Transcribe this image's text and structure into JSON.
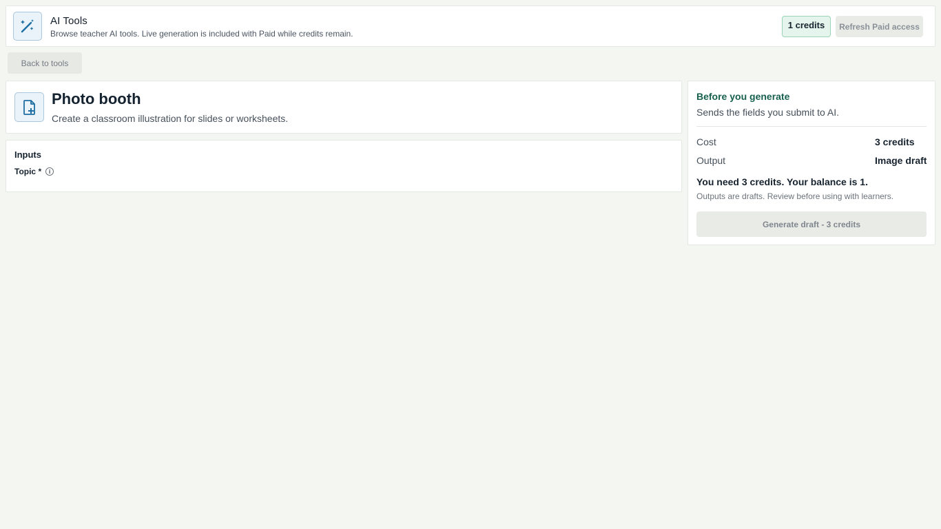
{
  "header": {
    "title": "AI Tools",
    "subtitle": "Browse teacher AI tools. Live generation is included with Paid while credits remain.",
    "credits_badge": "1 credits",
    "refresh_label": "Refresh Paid access",
    "icon": "magic-wand-icon"
  },
  "nav": {
    "back_label": "Back to tools"
  },
  "tool": {
    "title": "Photo booth",
    "description": "Create a classroom illustration for slides or worksheets.",
    "icon": "file-plus-icon"
  },
  "inputs": {
    "heading": "Inputs",
    "fields": [
      {
        "label": "Topic *",
        "info_icon": "info-icon"
      }
    ]
  },
  "side_panel": {
    "heading": "Before you generate",
    "subtitle": "Sends the fields you submit to AI.",
    "rows": [
      {
        "label": "Cost",
        "value": "3 credits"
      },
      {
        "label": "Output",
        "value": "Image draft"
      }
    ],
    "balance_warning": "You need 3 credits. Your balance is 1.",
    "note": "Outputs are drafts. Review before using with learners.",
    "generate_label": "Generate draft - 3 credits"
  },
  "colors": {
    "page_bg": "#f4f6f1",
    "accent_green": "#17604d",
    "icon_blue": "#1c6da3",
    "badge_bg": "#e5f4ec"
  }
}
